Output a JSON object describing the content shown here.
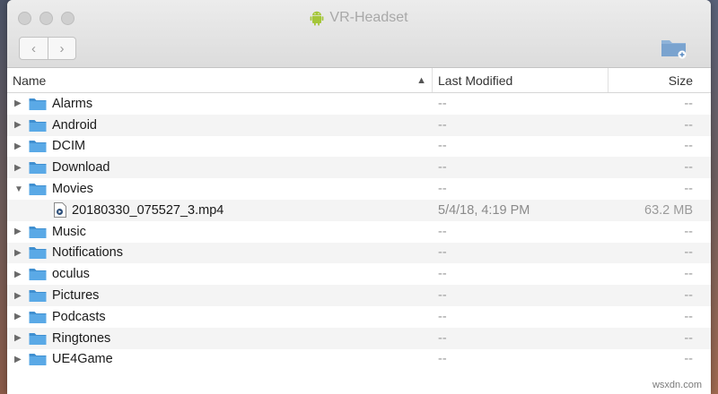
{
  "window": {
    "title": "VR-Headset",
    "nav_back": "‹",
    "nav_forward": "›"
  },
  "columns": {
    "name": "Name",
    "modified": "Last Modified",
    "size": "Size"
  },
  "rows": [
    {
      "name": "Alarms",
      "type": "folder",
      "expanded": false,
      "modified": "--",
      "size": "--"
    },
    {
      "name": "Android",
      "type": "folder",
      "expanded": false,
      "modified": "--",
      "size": "--"
    },
    {
      "name": "DCIM",
      "type": "folder",
      "expanded": false,
      "modified": "--",
      "size": "--"
    },
    {
      "name": "Download",
      "type": "folder",
      "expanded": false,
      "modified": "--",
      "size": "--"
    },
    {
      "name": "Movies",
      "type": "folder",
      "expanded": true,
      "modified": "--",
      "size": "--"
    },
    {
      "name": "20180330_075527_3.mp4",
      "type": "file",
      "expanded": false,
      "modified": "5/4/18, 4:19 PM",
      "size": "63.2 MB"
    },
    {
      "name": "Music",
      "type": "folder",
      "expanded": false,
      "modified": "--",
      "size": "--"
    },
    {
      "name": "Notifications",
      "type": "folder",
      "expanded": false,
      "modified": "--",
      "size": "--"
    },
    {
      "name": "oculus",
      "type": "folder",
      "expanded": false,
      "modified": "--",
      "size": "--"
    },
    {
      "name": "Pictures",
      "type": "folder",
      "expanded": false,
      "modified": "--",
      "size": "--"
    },
    {
      "name": "Podcasts",
      "type": "folder",
      "expanded": false,
      "modified": "--",
      "size": "--"
    },
    {
      "name": "Ringtones",
      "type": "folder",
      "expanded": false,
      "modified": "--",
      "size": "--"
    },
    {
      "name": "UE4Game",
      "type": "folder",
      "expanded": false,
      "modified": "--",
      "size": "--"
    }
  ],
  "watermark": "wsxdn.com",
  "colors": {
    "folder": "#5aa9e6",
    "folder_dark": "#3f8fd0",
    "android": "#a4c639"
  }
}
